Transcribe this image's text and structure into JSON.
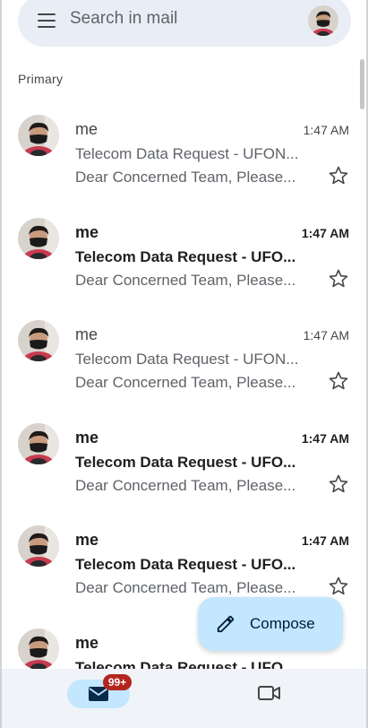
{
  "search": {
    "placeholder": "Search in mail"
  },
  "section": {
    "label": "Primary"
  },
  "emails": [
    {
      "sender": "me",
      "time": "1:47 AM",
      "subject": "Telecom Data Request - UFON...",
      "preview": "Dear Concerned Team, Please...",
      "unread": false
    },
    {
      "sender": "me",
      "time": "1:47 AM",
      "subject": "Telecom Data Request - UFO...",
      "preview": "Dear Concerned Team, Please...",
      "unread": true
    },
    {
      "sender": "me",
      "time": "1:47 AM",
      "subject": "Telecom Data Request - UFON...",
      "preview": "Dear Concerned Team, Please...",
      "unread": false
    },
    {
      "sender": "me",
      "time": "1:47 AM",
      "subject": "Telecom Data Request - UFO...",
      "preview": "Dear Concerned Team, Please...",
      "unread": true
    },
    {
      "sender": "me",
      "time": "1:47 AM",
      "subject": "Telecom Data Request - UFO...",
      "preview": "Dear Concerned Team, Please...",
      "unread": true
    },
    {
      "sender": "me",
      "time": "",
      "subject": "Telecom Data Request - UFO",
      "preview": "",
      "unread": true
    }
  ],
  "compose": {
    "label": "Compose"
  },
  "nav": {
    "mail_badge": "99+"
  },
  "colors": {
    "accent": "#c2e7ff",
    "badge": "#b3261e",
    "search_bg": "#e9eef6",
    "nav_bg": "#f0f3f8"
  },
  "icons": {
    "menu": "menu-icon",
    "star": "star-icon",
    "compose": "pencil-icon",
    "mail": "mail-icon",
    "meet": "video-icon"
  }
}
